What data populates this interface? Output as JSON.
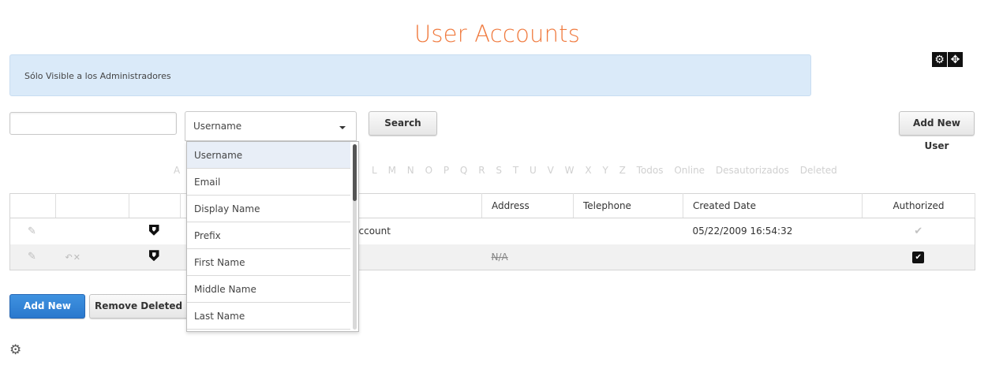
{
  "page": {
    "title": "User Accounts"
  },
  "banner": {
    "text": "Sólo Visible a los Administradores"
  },
  "search": {
    "input_value": "",
    "field_selected": "Username",
    "button_label": "Search",
    "options": [
      "Username",
      "Email",
      "Display Name",
      "Prefix",
      "First Name",
      "Middle Name",
      "Last Name"
    ]
  },
  "toolbar": {
    "add_new_user_label": "Add New User"
  },
  "filter_bar": {
    "letters_left": [
      "A"
    ],
    "letters_right": [
      "L",
      "M",
      "N",
      "O",
      "P",
      "Q",
      "R",
      "S",
      "T",
      "U",
      "V",
      "W",
      "X",
      "Y",
      "Z"
    ],
    "extras": [
      "Todos",
      "Online",
      "Desautorizados",
      "Deleted"
    ]
  },
  "table": {
    "headers": [
      "",
      "",
      "",
      "",
      "Address",
      "Telephone",
      "Created Date",
      "Authorized"
    ],
    "rows": [
      {
        "name_partial": "Account",
        "address": "",
        "telephone": "",
        "created": "05/22/2009 16:54:32",
        "authorized": "check-grey"
      },
      {
        "name_partial": "",
        "address": "N/A",
        "telephone": "",
        "created": "",
        "authorized": "checkbox-checked"
      }
    ]
  },
  "footer": {
    "add_new_user_label": "Add New User",
    "remove_deleted_label": "Remove Deleted Us"
  },
  "icons": {
    "corner": [
      "gear-icon",
      "move-icon"
    ],
    "row_actions": [
      "pencil-icon",
      "restore-icon",
      "delete-icon",
      "shield-icon"
    ],
    "bottom": "gear-icon"
  },
  "colors": {
    "title": "#f07a3e",
    "banner_bg": "#daeaf9",
    "primary_button": "#2a78cd"
  }
}
